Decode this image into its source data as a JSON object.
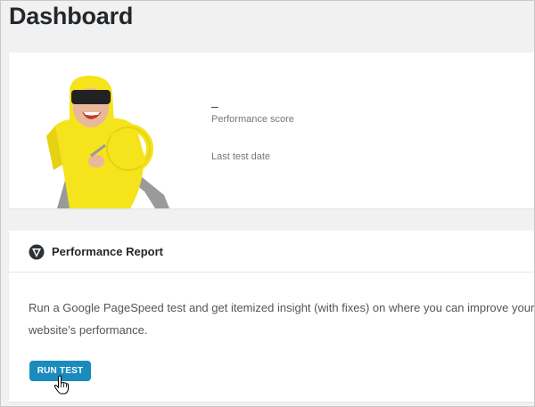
{
  "page": {
    "title": "Dashboard"
  },
  "score_card": {
    "score_value": "–",
    "score_label": "Performance score",
    "date_label": "Last test date",
    "mascot": "mascot-illustration"
  },
  "report": {
    "icon": "pagespeed-icon",
    "title": "Performance Report",
    "description": "Run a Google PageSpeed test and get itemized insight (with fixes) on where you can improve your website’s performance.",
    "run_label": "RUN TEST"
  },
  "colors": {
    "accent": "#1a8bbd",
    "mascot_yellow": "#f5e31c",
    "background": "#f1f1f1"
  }
}
